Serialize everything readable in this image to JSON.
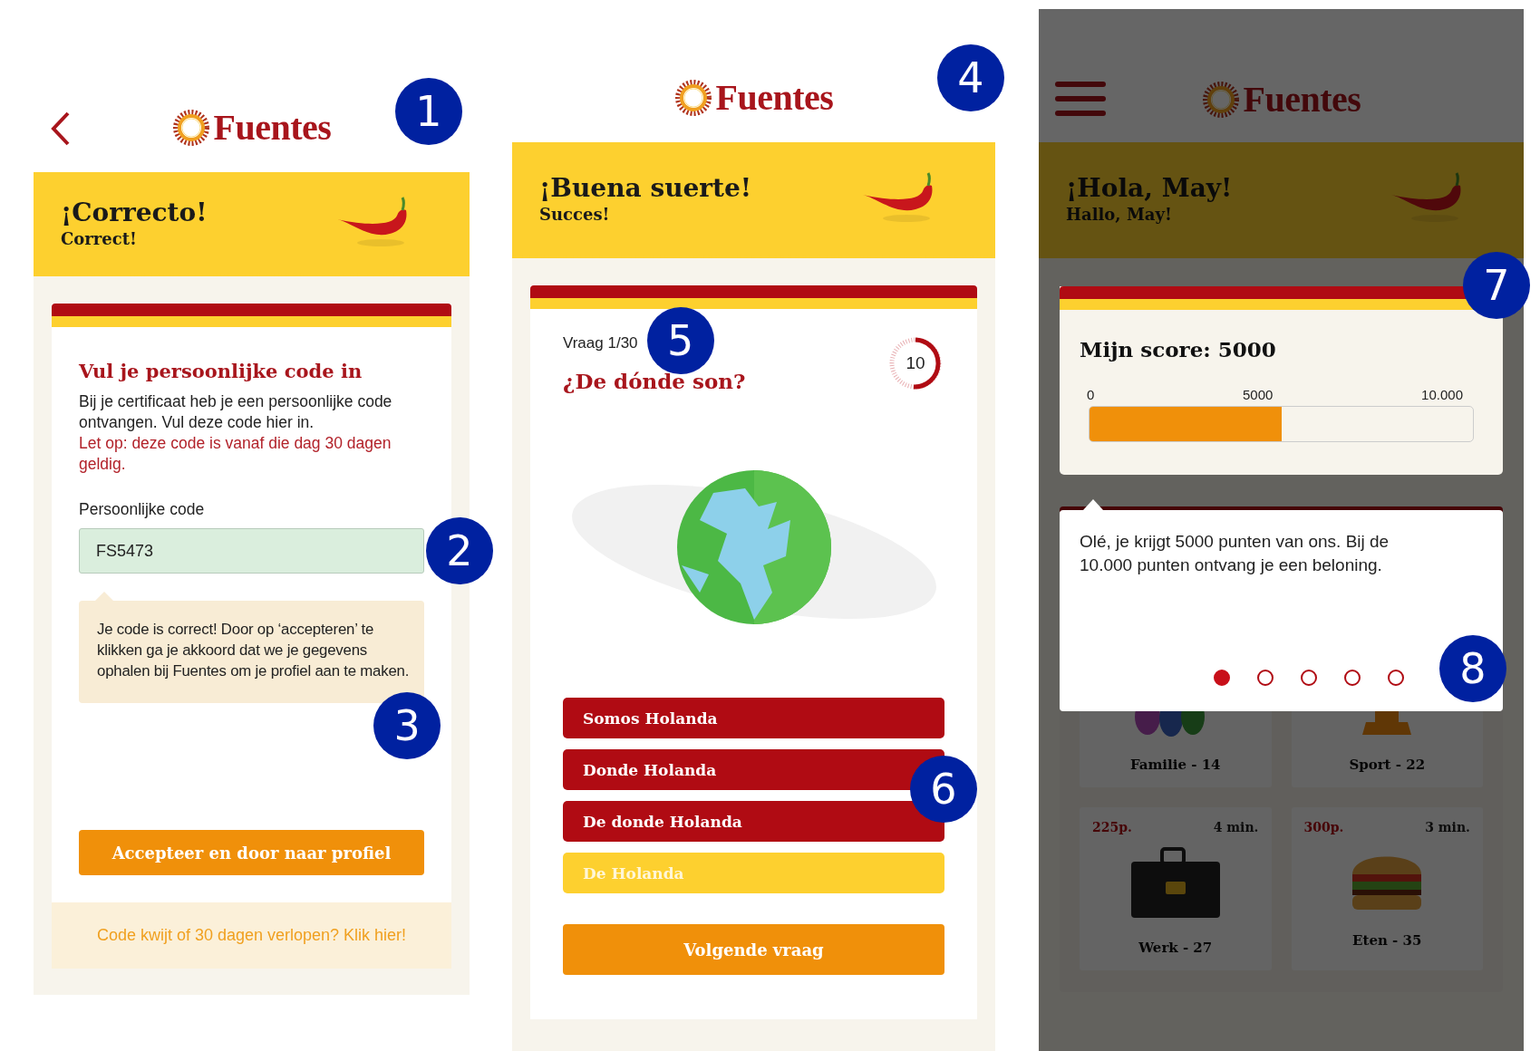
{
  "screens": [
    {
      "kind": "code_entry",
      "dimmed": false,
      "header": {
        "kind": "back",
        "logo": "Fuentes",
        "callout": "1"
      },
      "banner": {
        "title": "¡Correcto!",
        "subtitle": "Correct!"
      },
      "card": {
        "title": "Vul je persoonlijke code in",
        "intro": "Bij je certificaat heb je een persoonlijke code ontvangen. Vul deze code hier in.",
        "warning": "Let op: deze code is vanaf die dag 30 dagen geldig.",
        "field_label": "Persoonlijke code",
        "field_value": "FS5473",
        "field_callout": "2",
        "notice": "Je code is correct! Door op ‘accepteren’ te klikken ga je akkoord dat we je gegevens ophalen bij Fuentes om je profiel aan te maken.",
        "notice_callout": "3",
        "button": "Accepteer en door naar profiel"
      },
      "footer_link": "Code kwijt of 30 dagen verlopen? Klik hier!"
    },
    {
      "kind": "quiz",
      "dimmed": false,
      "header": {
        "kind": "plain",
        "logo": "Fuentes",
        "callout": "4"
      },
      "banner": {
        "title": "¡Buena suerte!",
        "subtitle": "Succes!"
      },
      "quiz": {
        "counter": "Vraag 1/30",
        "counter_callout": "5",
        "question": "¿De dónde son?",
        "timer": {
          "value": "10"
        },
        "answers": [
          {
            "label": "Somos Holanda",
            "selected": false
          },
          {
            "label": "Donde Holanda",
            "selected": false
          },
          {
            "label": "De donde Holanda",
            "selected": false
          },
          {
            "label": "De Holanda",
            "selected": true
          }
        ],
        "answers_callout": "6",
        "button": "Volgende vraag"
      }
    },
    {
      "kind": "home",
      "dimmed": true,
      "header": {
        "kind": "menu",
        "logo": "Fuentes"
      },
      "banner": {
        "title": "¡Hola, May!",
        "subtitle": "Hallo, May!"
      },
      "score": {
        "title": "Mijn score: 5000",
        "ticks": [
          "0",
          "5000",
          "10.000"
        ],
        "level": 0.5,
        "callout": "7"
      },
      "tooltip": {
        "text": "Olé, je krijgt 5000 punten van ons. Bij de 10.000 punten ontvang je een beloning.",
        "dots": [
          {
            "selected": true
          },
          {
            "selected": false
          },
          {
            "selected": false
          },
          {
            "selected": false
          },
          {
            "selected": false
          }
        ],
        "callout": "8"
      },
      "categories": [
        {
          "kind": "family",
          "label": "Familie - 14"
        },
        {
          "kind": "sport",
          "label": "Sport - 22"
        },
        {
          "kind": "work",
          "points": "225p.",
          "time": "4 min.",
          "label": "Werk - 27"
        },
        {
          "kind": "food",
          "points": "300p.",
          "time": "3 min.",
          "label": "Eten - 35"
        }
      ]
    }
  ]
}
